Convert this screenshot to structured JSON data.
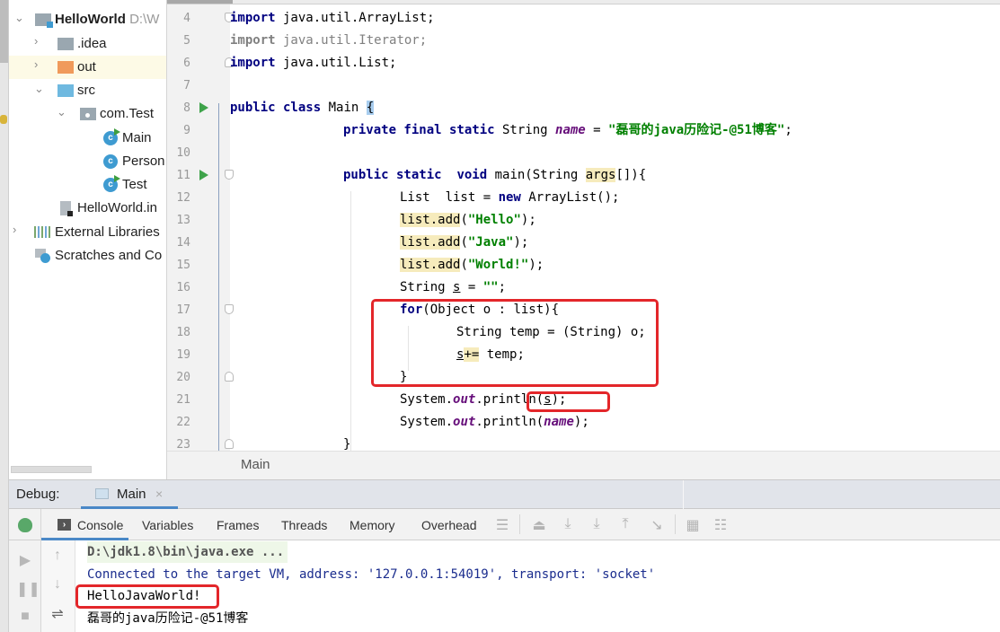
{
  "project_tree": {
    "items": [
      {
        "label": "HelloWorld",
        "suffix": "D:\\W",
        "type": "project",
        "expanded": true
      },
      {
        "label": ".idea",
        "type": "folder",
        "expanded": false
      },
      {
        "label": "out",
        "type": "folder-excluded",
        "expanded": false,
        "selected": true
      },
      {
        "label": "src",
        "type": "source-folder",
        "expanded": true
      },
      {
        "label": "com.Test",
        "type": "package",
        "expanded": true
      },
      {
        "label": "Main",
        "type": "class-runnable"
      },
      {
        "label": "Person",
        "type": "class"
      },
      {
        "label": "Test",
        "type": "class-runnable"
      },
      {
        "label": "HelloWorld.in",
        "type": "module-file"
      },
      {
        "label": "External Libraries",
        "type": "libraries",
        "expanded": false
      },
      {
        "label": "Scratches and Co",
        "type": "scratches"
      }
    ],
    "class_glyph": "c"
  },
  "editor": {
    "line_numbers": [
      "4",
      "5",
      "6",
      "7",
      "8",
      "9",
      "10",
      "11",
      "12",
      "13",
      "14",
      "15",
      "16",
      "17",
      "18",
      "19",
      "20",
      "21",
      "22",
      "23"
    ],
    "code": {
      "l4": {
        "kw": "import",
        "rest": " java.util.ArrayList;"
      },
      "l5": {
        "kw": "import",
        "rest": " java.util.Iterator;"
      },
      "l6": {
        "kw": "import",
        "rest": " java.util.List;"
      },
      "l8": {
        "kw": "public class",
        "name": " Main ",
        "brace": "{"
      },
      "l9": {
        "kw": "private final static",
        "type": " String ",
        "field": "name",
        "eq": " = ",
        "str": "\"磊哥的java历险记-@51博客\"",
        "end": ";"
      },
      "l11": {
        "kw1": "public static",
        "sp": "  ",
        "kw2": "void",
        "rest1": " main(String ",
        "args": "args",
        "rest2": "[]){"
      },
      "l12": {
        "a": "List  list = ",
        "kw": "new",
        "b": " ArrayList();"
      },
      "l13": {
        "a": "list.add",
        "b": "(",
        "str": "\"Hello\"",
        "c": ");"
      },
      "l14": {
        "a": "list.add",
        "b": "(",
        "str": "\"Java\"",
        "c": ");"
      },
      "l15": {
        "a": "list.add",
        "b": "(",
        "str": "\"World!\"",
        "c": ");"
      },
      "l16": {
        "a": "String ",
        "var": "s",
        "b": " = ",
        "str": "\"\"",
        "c": ";"
      },
      "l17": {
        "kw": "for",
        "rest": "(Object o : list){"
      },
      "l18": {
        "text": "String temp = (String) o;"
      },
      "l19": {
        "var": "s",
        "op": "+=",
        "rest": " temp;"
      },
      "l20": {
        "text": "}"
      },
      "l21": {
        "a": "System.",
        "fld": "out",
        "b": ".println(",
        "var": "s",
        "c": ");"
      },
      "l22": {
        "a": "System.",
        "fld": "out",
        "b": ".println(",
        "fld2": "name",
        "c": ");"
      },
      "l23": {
        "text": "}"
      }
    },
    "breadcrumb": "Main"
  },
  "debug": {
    "title": "Debug:",
    "session_tab": "Main",
    "close_glyph": "×",
    "tabs": [
      "Console",
      "Variables",
      "Frames",
      "Threads",
      "Memory",
      "Overhead"
    ],
    "console_lines": {
      "cmd": "D:\\jdk1.8\\bin\\java.exe ...",
      "connected": "Connected to the target VM, address: '127.0.0.1:54019', transport: 'socket'",
      "output1": "HelloJavaWorld!",
      "output2": "磊哥的java历险记-@51博客"
    }
  },
  "colors": {
    "annotation_red": "#e3262a",
    "keyword": "#000080",
    "string": "#008000",
    "field": "#660e7a",
    "accent_blue": "#4a88c7"
  }
}
